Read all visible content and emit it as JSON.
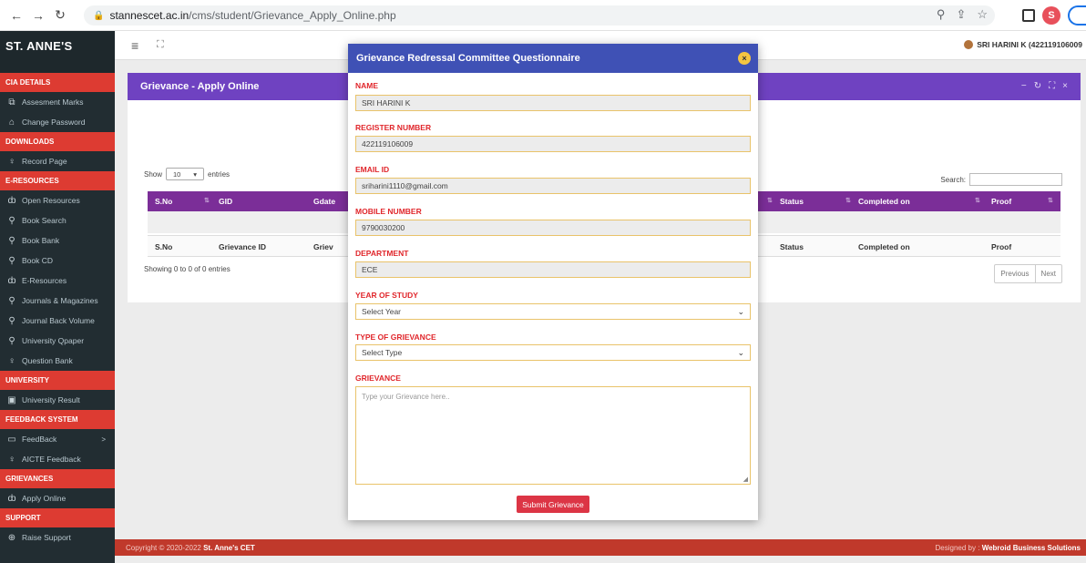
{
  "browser": {
    "url_host": "stannescet.ac.in",
    "url_path": "/cms/student/Grievance_Apply_Online.php",
    "profile_initial": "S"
  },
  "sidebar": {
    "brand": "ST. ANNE'S",
    "sections": [
      {
        "title": "CIA DETAILS",
        "items": [
          {
            "label": "Assesment Marks",
            "icon": "copy-icon"
          },
          {
            "label": "Change Password",
            "icon": "lock-icon"
          }
        ]
      },
      {
        "title": "DOWNLOADS",
        "items": [
          {
            "label": "Record Page",
            "icon": "bulb-icon"
          }
        ]
      },
      {
        "title": "E-RESOURCES",
        "items": [
          {
            "label": "Open Resources",
            "icon": "fire-icon"
          },
          {
            "label": "Book Search",
            "icon": "search-icon"
          },
          {
            "label": "Book Bank",
            "icon": "search-icon"
          },
          {
            "label": "Book CD",
            "icon": "search-icon"
          },
          {
            "label": "E-Resources",
            "icon": "fire-icon"
          },
          {
            "label": "Journals & Magazines",
            "icon": "search-icon"
          },
          {
            "label": "Journal Back Volume",
            "icon": "search-icon"
          },
          {
            "label": "University Qpaper",
            "icon": "search-icon"
          },
          {
            "label": "Question Bank",
            "icon": "bulb-icon"
          }
        ]
      },
      {
        "title": "UNIVERSITY",
        "items": [
          {
            "label": "University Result",
            "icon": "calendar-icon"
          }
        ]
      },
      {
        "title": "FEEDBACK SYSTEM",
        "items": [
          {
            "label": "FeedBack",
            "icon": "comment-icon"
          },
          {
            "label": "AICTE Feedback",
            "icon": "bulb-icon"
          }
        ]
      },
      {
        "title": "GRIEVANCES",
        "items": [
          {
            "label": "Apply Online",
            "icon": "fire-icon"
          }
        ]
      },
      {
        "title": "SUPPORT",
        "items": [
          {
            "label": "Raise Support",
            "icon": "lifebuoy-icon"
          }
        ]
      }
    ]
  },
  "header": {
    "user": "SRI HARINI K (422119106009"
  },
  "panel": {
    "title": "Grievance - Apply Online",
    "show_label": "Show",
    "entries_value": "10",
    "entries_label": "entries",
    "search_label": "Search:",
    "columns": [
      "S.No",
      "GID",
      "Gdate",
      "Status",
      "Completed on",
      "Proof"
    ],
    "footer_columns": [
      "S.No",
      "Grievance ID",
      "Griev",
      "Status",
      "Completed on",
      "Proof"
    ],
    "showing": "Showing 0 to 0 of 0 entries",
    "previous": "Previous",
    "next": "Next"
  },
  "footer": {
    "copyright": "Copyright © 2020-2022",
    "org": "St. Anne's CET",
    "designed_by": "Designed by :",
    "designer": "Webroid Business Solutions"
  },
  "modal": {
    "title": "Grievance Redressal Committee Questionnaire",
    "close": "×",
    "name_label": "NAME",
    "name_value": "SRI HARINI K",
    "register_label": "REGISTER NUMBER",
    "register_value": "422119106009",
    "email_label": "EMAIL ID",
    "email_value": "sriharini1110@gmail.com",
    "mobile_label": "MOBILE NUMBER",
    "mobile_value": "9790030200",
    "dept_label": "DEPARTMENT",
    "dept_value": "ECE",
    "year_label": "YEAR OF STUDY",
    "year_value": "Select Year",
    "type_label": "TYPE OF GRIEVANCE",
    "type_value": "Select Type",
    "grievance_label": "GRIEVANCE",
    "grievance_placeholder": "Type your Grievance here..",
    "submit": "Submit Grievance"
  }
}
